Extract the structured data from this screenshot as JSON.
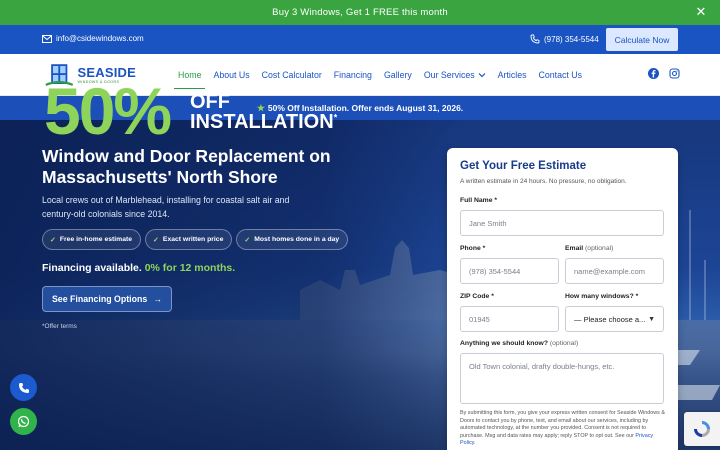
{
  "promo": {
    "text": "Buy 3 Windows, Get 1 FREE this month"
  },
  "contact": {
    "email": "info@csidewindows.com",
    "phone": "(978) 354-5544",
    "cta": "Calculate Now"
  },
  "brand": {
    "name": "SEASIDE",
    "tagline": "WINDOWS & DOORS"
  },
  "nav": {
    "items": [
      {
        "label": "Home"
      },
      {
        "label": "About Us"
      },
      {
        "label": "Cost Calculator"
      },
      {
        "label": "Financing"
      },
      {
        "label": "Gallery"
      },
      {
        "label": "Our Services"
      },
      {
        "label": "Articles"
      },
      {
        "label": "Contact Us"
      }
    ],
    "active": "Home"
  },
  "offer_strip": {
    "text": "50% Off Installation. Offer ends August 31, 2026."
  },
  "hero": {
    "big_number": "50%",
    "off": "OFF",
    "installation": "INSTALLATION",
    "asterisk": "*",
    "headline": "Window and Door Replacement on Massachusetts' North Shore",
    "subtext": "Local crews out of Marblehead, installing for coastal salt air and century-old colonials since 2014.",
    "chips": [
      "Free in-home estimate",
      "Exact written price",
      "Most homes done in a day"
    ],
    "financing_lead": "Financing available.",
    "financing_highlight": "0% for 12 months.",
    "financing_button": "See Financing Options",
    "terms": "*Offer terms"
  },
  "form": {
    "title": "Get Your Free Estimate",
    "subtitle": "A written estimate in 24 hours. No pressure, no obligation.",
    "full_name": {
      "label": "Full Name",
      "req": "*",
      "placeholder": "Jane Smith"
    },
    "phone": {
      "label": "Phone",
      "req": "*",
      "placeholder": "(978) 354-5544"
    },
    "email": {
      "label": "Email",
      "optional": "(optional)",
      "placeholder": "name@example.com"
    },
    "zip": {
      "label": "ZIP Code",
      "req": "*",
      "placeholder": "01945"
    },
    "windows": {
      "label": "How many windows?",
      "req": "*",
      "selected": "— Please choose a..."
    },
    "notes": {
      "label": "Anything we should know?",
      "optional": "(optional)",
      "placeholder": "Old Town colonial, drafty double-hungs, etc."
    },
    "consent": "By submitting this form, you give your express written consent for Seaside Windows & Doors to contact you by phone, text, and email about our services, including by automated technology, at the number you provided. Consent is not required to purchase. Msg and data rates may apply; reply STOP to opt out. See our",
    "privacy_link": "Privacy Policy."
  },
  "colors": {
    "green": "#3aa540",
    "blue": "#1a54c2",
    "lime": "#8fd45a",
    "navy": "#183b8a"
  }
}
